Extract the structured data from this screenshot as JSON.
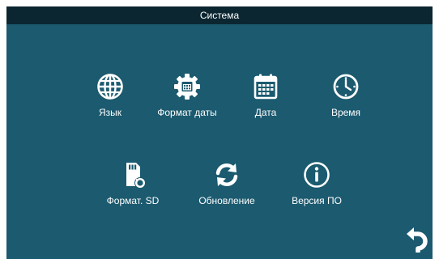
{
  "window": {
    "title": "Система"
  },
  "menu": {
    "row1": [
      {
        "label": "Язык",
        "icon": "globe-icon"
      },
      {
        "label": "Формат даты",
        "icon": "gear-calendar-icon"
      },
      {
        "label": "Дата",
        "icon": "calendar-icon"
      },
      {
        "label": "Время",
        "icon": "clock-icon"
      }
    ],
    "row2": [
      {
        "label": "Формат. SD",
        "icon": "sd-card-format-icon"
      },
      {
        "label": "Обновление",
        "icon": "refresh-icon"
      },
      {
        "label": "Версия ПО",
        "icon": "info-icon"
      }
    ]
  },
  "footer": {
    "back_icon": "back-arrow-icon"
  },
  "colors": {
    "background": "#1b5a6f",
    "titlebar": "#0b2630",
    "text": "#ffffff"
  }
}
